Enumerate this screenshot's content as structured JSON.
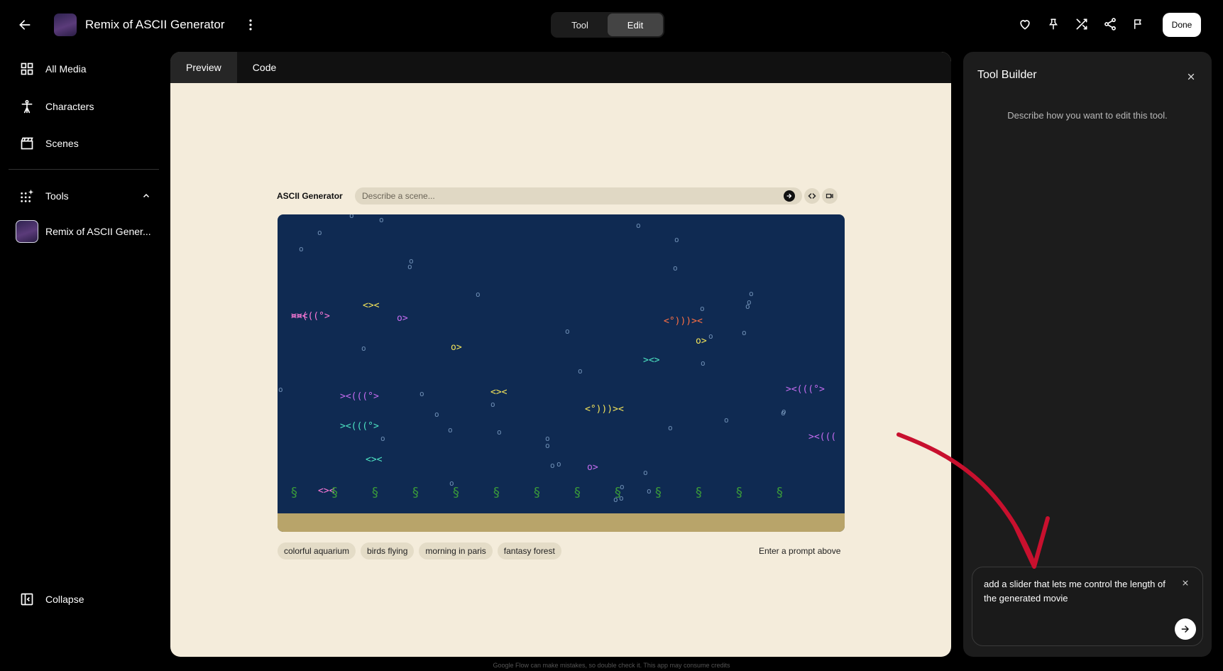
{
  "header": {
    "app_title": "Remix of ASCII Generator",
    "modes": [
      "Tool",
      "Edit"
    ],
    "active_mode": "Edit",
    "done_label": "Done",
    "icons": [
      "heart-icon",
      "pin-icon",
      "shuffle-icon",
      "share-icon",
      "flag-icon"
    ]
  },
  "sidebar": {
    "items": [
      {
        "label": "All Media",
        "icon": "grid-icon"
      },
      {
        "label": "Characters",
        "icon": "person-icon"
      },
      {
        "label": "Scenes",
        "icon": "clapperboard-icon"
      }
    ],
    "tools_label": "Tools",
    "tool_item_label": "Remix of ASCII Gener...",
    "collapse_label": "Collapse"
  },
  "main": {
    "tabs": [
      "Preview",
      "Code"
    ],
    "active_tab": "Preview",
    "generator": {
      "title": "ASCII Generator",
      "placeholder": "Describe a scene...",
      "suggestions": [
        "colorful aquarium",
        "birds flying",
        "morning in paris",
        "fantasy forest"
      ],
      "status": "Enter a prompt above"
    },
    "scene": {
      "background": "#0f2a52",
      "sand": "#b8a46a",
      "fish": [
        {
          "text": "<><",
          "color": "#ff7ad9"
        },
        {
          "text": "><(((°>",
          "color": "#ff7ad9"
        },
        {
          "text": "<><",
          "color": "#f2e35a"
        },
        {
          "text": "o>",
          "color": "#c56cf0"
        },
        {
          "text": "o>",
          "color": "#f2e35a"
        },
        {
          "text": "<°)))><",
          "color": "#ff7043"
        },
        {
          "text": "o>",
          "color": "#f2e35a"
        },
        {
          "text": "><>",
          "color": "#4de3c3"
        },
        {
          "text": "><(((°>",
          "color": "#c56cf0"
        },
        {
          "text": "<><",
          "color": "#f2e35a"
        },
        {
          "text": "<°)))><",
          "color": "#f2e35a"
        },
        {
          "text": "><(((°>",
          "color": "#c56cf0"
        },
        {
          "text": "><(((°>",
          "color": "#4de3c3"
        },
        {
          "text": "><(((",
          "color": "#c56cf0"
        },
        {
          "text": "<><",
          "color": "#4de3c3"
        },
        {
          "text": "o>",
          "color": "#c56cf0"
        },
        {
          "text": "<><",
          "color": "#ff7ad9"
        }
      ],
      "bubble": "o",
      "seaweed": "§"
    }
  },
  "builder": {
    "title": "Tool Builder",
    "hint": "Describe how you want to edit this tool.",
    "prompt": "add a slider that lets me control the length of the generated movie"
  },
  "footer": {
    "note": "Google Flow can make mistakes, so double check it. This app may consume credits"
  },
  "colors": {
    "accent_arrow": "#c8102e",
    "panel": "#1c1c1c",
    "preview_bg": "#f4ecdb"
  }
}
